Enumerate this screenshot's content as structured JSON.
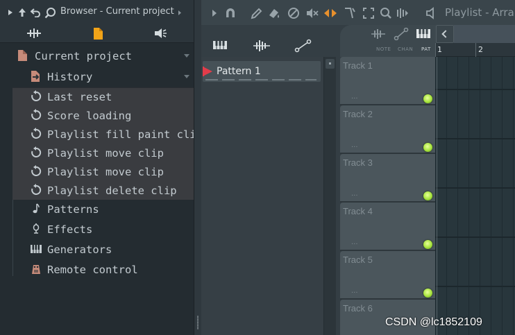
{
  "browser": {
    "title": "Browser - Current project",
    "tabs": [
      "all-files-icon",
      "current-project-icon",
      "plugin-database-icon"
    ],
    "root": {
      "label": "Current project",
      "icon": "folder-icon"
    },
    "history": {
      "label": "History",
      "items": [
        {
          "label": "Last reset"
        },
        {
          "label": "Score loading"
        },
        {
          "label": "Playlist fill paint clip"
        },
        {
          "label": "Playlist move clip"
        },
        {
          "label": "Playlist move clip"
        },
        {
          "label": "Playlist delete clip"
        }
      ]
    },
    "folders": [
      {
        "label": "Patterns",
        "icon": "note-icon"
      },
      {
        "label": "Effects",
        "icon": "effects-icon"
      },
      {
        "label": "Generators",
        "icon": "piano-icon"
      },
      {
        "label": "Remote control",
        "icon": "remote-icon"
      }
    ]
  },
  "playlist": {
    "title": "Playlist - Arra",
    "pattern": {
      "label": "Pattern 1",
      "accent": "#e23c4a"
    },
    "track_tabs": [
      "NOTE",
      "CHAN",
      "PAT"
    ],
    "ruler": [
      "1",
      "2"
    ],
    "tracks": [
      {
        "name": "Track 1",
        "dots": "..."
      },
      {
        "name": "Track 2",
        "dots": "..."
      },
      {
        "name": "Track 3",
        "dots": "..."
      },
      {
        "name": "Track 4",
        "dots": "..."
      },
      {
        "name": "Track 5",
        "dots": "..."
      },
      {
        "name": "Track 6",
        "dots": "..."
      }
    ],
    "led_color": "#a7e43c"
  },
  "watermark": "CSDN @lc1852109"
}
